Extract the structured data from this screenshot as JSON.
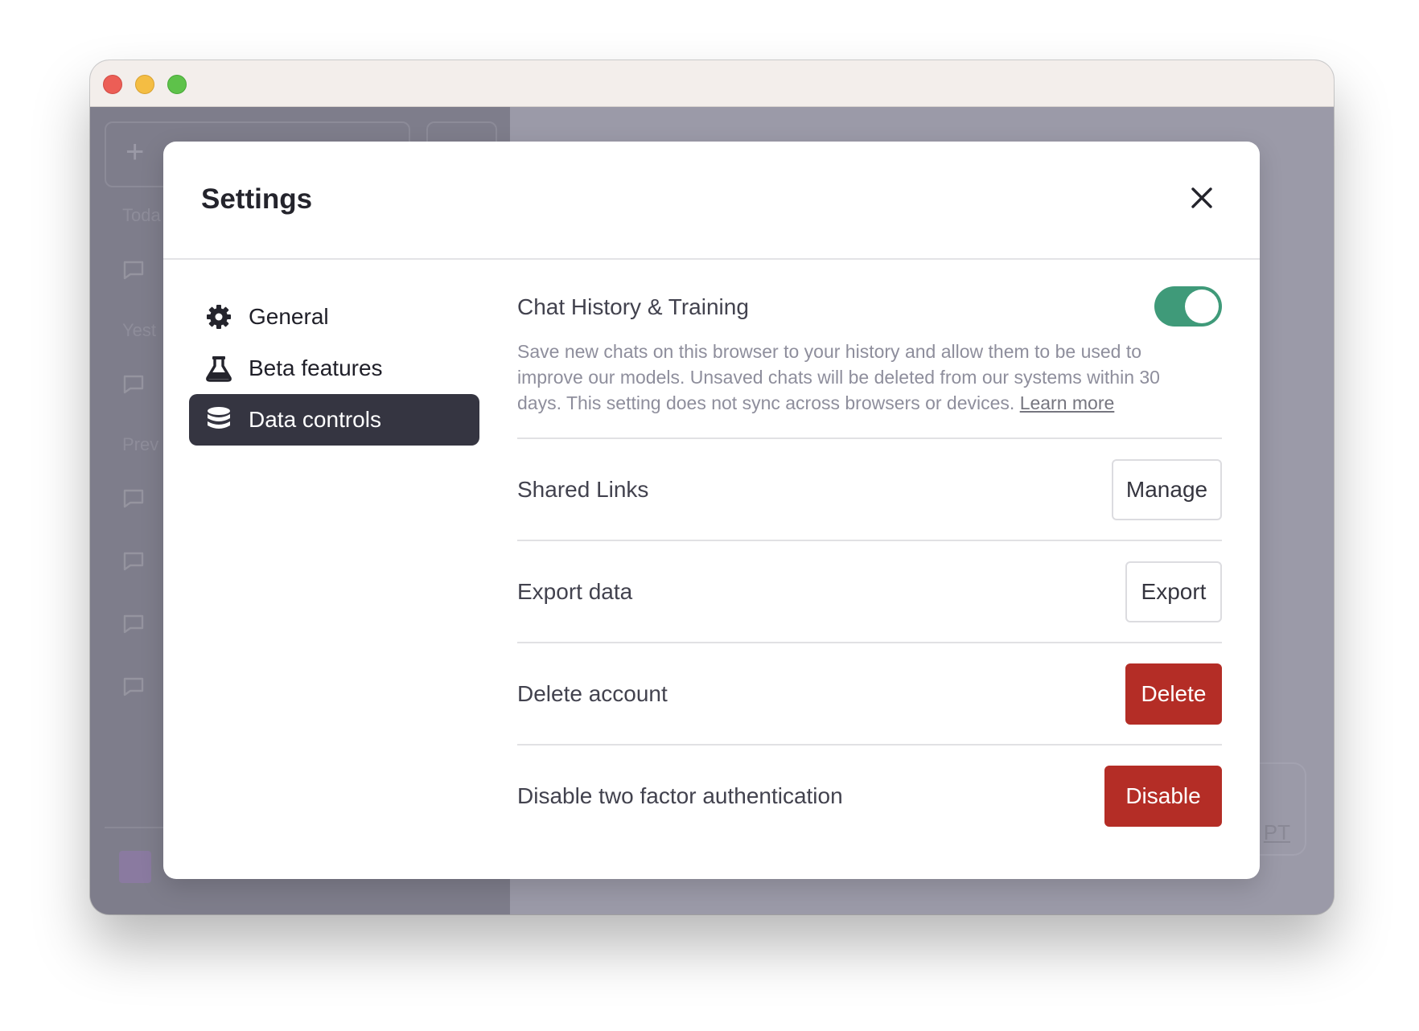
{
  "window": {
    "traffic_lights": [
      "close",
      "minimize",
      "zoom"
    ]
  },
  "background_app": {
    "sidebar_sections": [
      "Toda",
      "Yest",
      "Prev"
    ],
    "main_link_fragment": "PT"
  },
  "modal": {
    "title": "Settings",
    "close_icon": "close-icon"
  },
  "nav": {
    "items": [
      {
        "label": "General",
        "icon": "gear-icon",
        "active": false
      },
      {
        "label": "Beta features",
        "icon": "flask-icon",
        "active": false
      },
      {
        "label": "Data controls",
        "icon": "database-icon",
        "active": true
      }
    ]
  },
  "data_controls": {
    "chat_history": {
      "title": "Chat History & Training",
      "enabled": true,
      "description": "Save new chats on this browser to your history and allow them to be used to improve our models. Unsaved chats will be deleted from our systems within 30 days. This setting does not sync across browsers or devices.",
      "learn_more": "Learn more"
    },
    "rows": [
      {
        "label": "Shared Links",
        "button": "Manage",
        "style": "outline"
      },
      {
        "label": "Export data",
        "button": "Export",
        "style": "outline"
      },
      {
        "label": "Delete account",
        "button": "Delete",
        "style": "danger"
      },
      {
        "label": "Disable two factor authentication",
        "button": "Disable",
        "style": "danger"
      }
    ]
  },
  "colors": {
    "toggle_on": "#3f9a79",
    "danger": "#b42d26",
    "active_nav": "#353541"
  }
}
